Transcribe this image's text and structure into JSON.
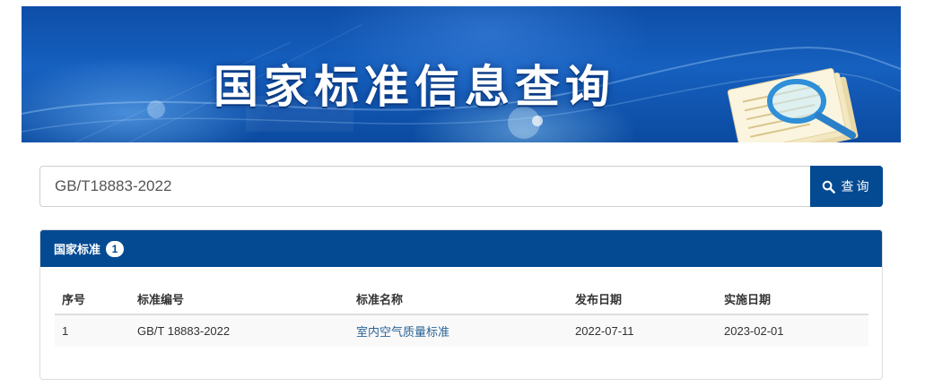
{
  "banner": {
    "title": "国家标准信息查询"
  },
  "search": {
    "value": "GB/T18883-2022",
    "button_label": "查询"
  },
  "panel": {
    "title": "国家标准",
    "count": "1"
  },
  "table": {
    "headers": [
      "序号",
      "标准编号",
      "标准名称",
      "发布日期",
      "实施日期"
    ],
    "rows": [
      [
        "1",
        "GB/T 18883-2022",
        "室内空气质量标准",
        "2022-07-11",
        "2023-02-01"
      ]
    ]
  },
  "colors": {
    "primary": "#034a92",
    "link": "#2a6496",
    "row_bg": "#f9f9f9"
  }
}
